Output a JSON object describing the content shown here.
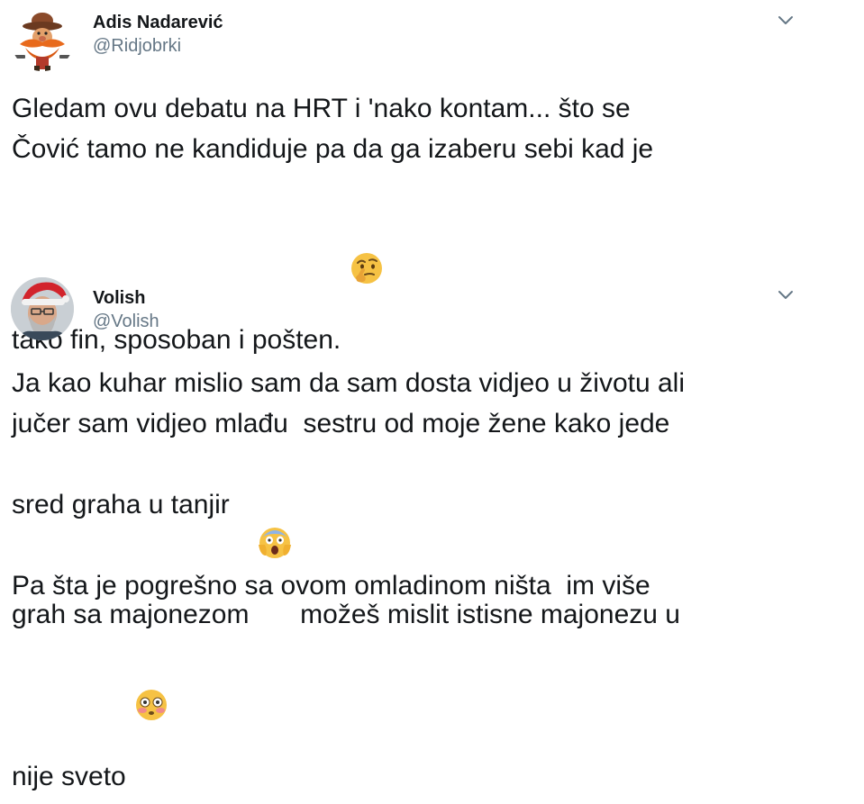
{
  "tweets": [
    {
      "display_name": "Adis Nadarević",
      "handle": "@Ridjobrki",
      "avatar_icon": "cartoon-cowboy-avatar",
      "menu_icon": "chevron-down-icon",
      "text_lines": [
        "Gledam ovu debatu na HRT i 'nako kontam... što se",
        "Čović tamo ne kandiduje pa da ga izaberu sebi kad je",
        "tako fin, sposoban i pošten. "
      ],
      "emoji": "thinking-face-emoji"
    },
    {
      "display_name": "Volish",
      "handle": "@Volish",
      "avatar_icon": "santa-hat-man-avatar",
      "menu_icon": "chevron-down-icon",
      "text_lines": [
        "Ja kao kuhar mislio sam da sam dosta vidjeo u životu ali",
        "jučer sam vidjeo mlađu  sestru od moje žene kako jede",
        "grah sa majonezom ",
        " možeš mislit istisne majonezu u",
        "sred graha u tanjir",
        "Pa šta je pogrešno sa ovom omladinom ništa  im više",
        "nije sveto "
      ],
      "emojis": [
        "face-screaming-in-fear-emoji",
        "flushed-face-emoji"
      ]
    }
  ],
  "colors": {
    "text": "#14171a",
    "secondary": "#657786",
    "background": "#ffffff"
  }
}
